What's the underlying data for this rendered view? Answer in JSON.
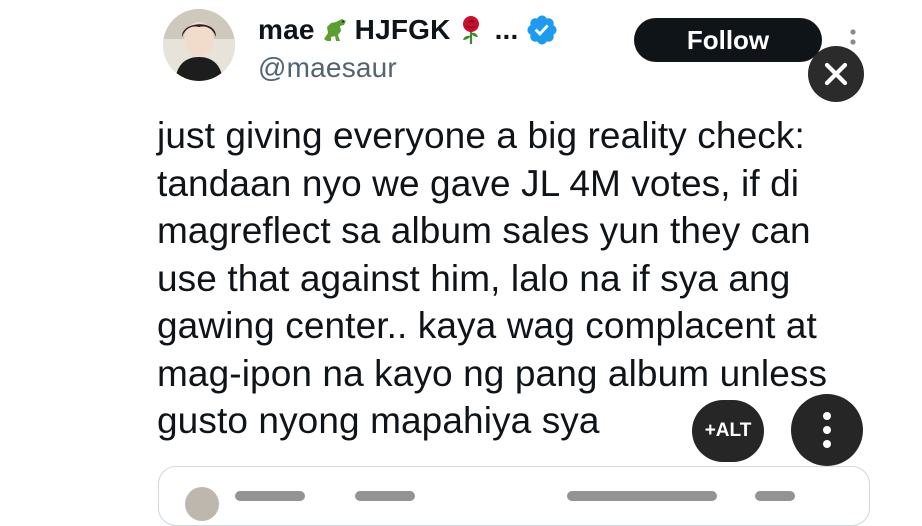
{
  "author": {
    "display_name_first": "mae",
    "display_name_second": "HJFGK",
    "name_ellipsis": "...",
    "handle": "@maesaur",
    "icons": [
      "dinosaur-emoji",
      "rose-emoji",
      "verified-badge-icon"
    ]
  },
  "actions": {
    "follow_label": "Follow",
    "alt_label": "+ALT"
  },
  "tweet": {
    "text": "just giving everyone a big reality check:\ntandaan nyo we gave JL 4M votes, if di\nmagreflect sa album sales yun they can\nuse that against him, lalo na if sya ang\ngawing center.. kaya wag complacent at\nmag-ipon na kayo ng pang album unless\ngusto nyong mapahiya sya"
  },
  "colors": {
    "text": "#0f1419",
    "secondary": "#536471",
    "verified": "#1d9bf0",
    "overlay_button": "#262626"
  }
}
